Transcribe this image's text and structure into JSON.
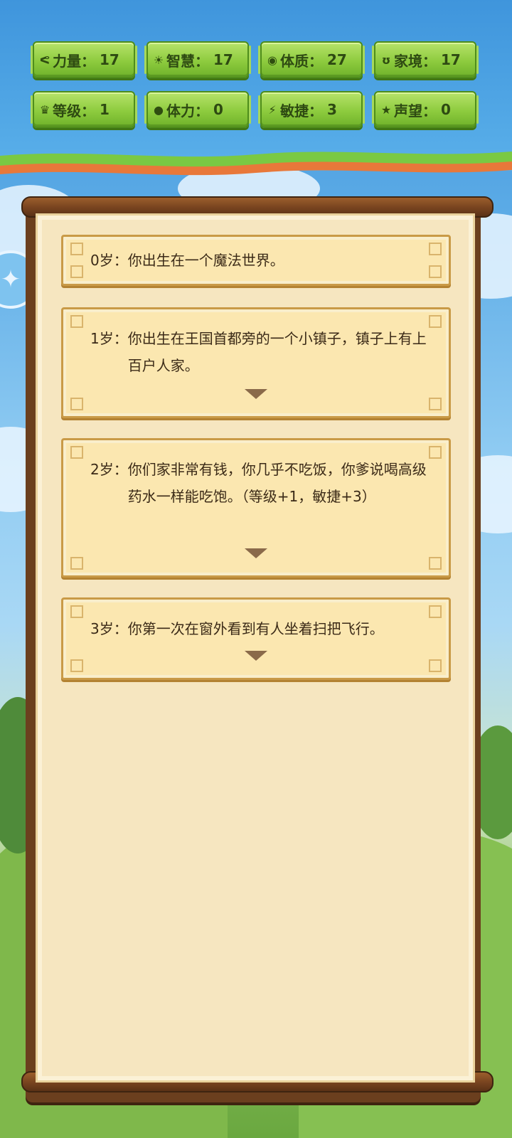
{
  "stats": [
    {
      "icon": "strength-icon",
      "glyph": "ᕙ",
      "label": "力量",
      "value": "17"
    },
    {
      "icon": "wisdom-icon",
      "glyph": "☀",
      "label": "智慧",
      "value": "17"
    },
    {
      "icon": "constitution-icon",
      "glyph": "◉",
      "label": "体质",
      "value": "27"
    },
    {
      "icon": "family-icon",
      "glyph": "ʊ",
      "label": "家境",
      "value": "17"
    },
    {
      "icon": "crown-icon",
      "glyph": "♛",
      "label": "等级",
      "value": "1"
    },
    {
      "icon": "heart-icon",
      "glyph": "●",
      "label": "体力",
      "value": "0"
    },
    {
      "icon": "lightning-icon",
      "glyph": "⚡",
      "label": "敏捷",
      "value": "3"
    },
    {
      "icon": "star-icon",
      "glyph": "★",
      "label": "声望",
      "value": "0"
    }
  ],
  "events": [
    {
      "age": "0岁",
      "text": "你出生在一个魔法世界。"
    },
    {
      "age": "1岁",
      "text": "你出生在王国首都旁的一个小镇子，镇子上有上百户人家。"
    },
    {
      "age": "2岁",
      "text": "你们家非常有钱，你几乎不吃饭，你爹说喝高级药水一样能吃饱。（等级+1，敏捷+3）"
    },
    {
      "age": "3岁",
      "text": "你第一次在窗外看到有人坐着扫把飞行。"
    }
  ],
  "separator": "："
}
